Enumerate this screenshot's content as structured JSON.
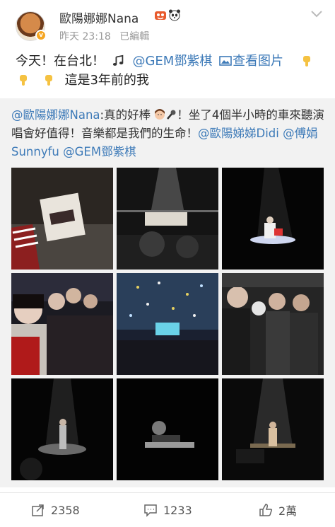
{
  "post": {
    "username": "歐陽娜娜Nana",
    "time": "昨天 23:18",
    "edited": "已編輯",
    "text_line1_prefix": "今天！在台北！",
    "mention_gem": "@GEM鄧紫棋",
    "view_image": "查看图片",
    "text_line2": "這是3年前的我"
  },
  "repost": {
    "mention_author": "@歐陽娜娜Nana",
    "text_part1": ":真的好棒",
    "text_part2": "！坐了4個半小時的車來聽演唱會好值得！音樂都是我們的生命！",
    "mention_didi": "@歐陽娣娣Didi",
    "mention_sunny": "@傅娟Sunnyfu",
    "mention_gem": "@GEM鄧紫棋"
  },
  "actions": {
    "share_count": "2358",
    "comment_count": "1233",
    "like_count": "2萬"
  },
  "icons": [
    "chevron-down-icon",
    "share-icon",
    "comment-icon",
    "like-icon",
    "pointing-hand-icon",
    "music-note-icon",
    "image-icon"
  ],
  "colors": {
    "link": "#3d7ab8",
    "repost_bg": "#f2f2f2",
    "text": "#333333",
    "meta": "#999999"
  }
}
